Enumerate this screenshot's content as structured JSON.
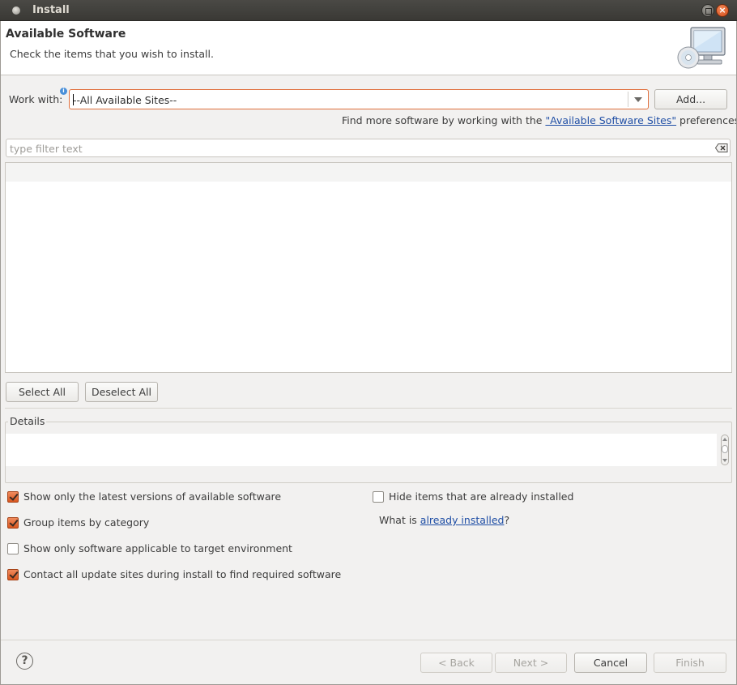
{
  "window": {
    "title": "Install"
  },
  "header": {
    "title": "Available Software",
    "description": "Check the items that you wish to install."
  },
  "work_with": {
    "label": "Work with:",
    "value": "--All Available Sites--",
    "add_button": "Add..."
  },
  "find_more": {
    "prefix": "Find more software by working with the ",
    "link": "\"Available Software Sites\"",
    "suffix": " preferences."
  },
  "filter": {
    "placeholder": "type filter text"
  },
  "selection_buttons": {
    "select_all": "Select All",
    "deselect_all": "Deselect All"
  },
  "details": {
    "label": "Details"
  },
  "options": {
    "left": [
      {
        "label": "Show only the latest versions of available software",
        "checked": true
      },
      {
        "label": "Group items by category",
        "checked": true
      },
      {
        "label": "Show only software applicable to target environment",
        "checked": false
      },
      {
        "label": "Contact all update sites during install to find required software",
        "checked": true
      }
    ],
    "right": [
      {
        "label": "Hide items that are already installed",
        "checked": false
      }
    ]
  },
  "what_is": {
    "prefix": "What is ",
    "link": "already installed",
    "suffix": "?"
  },
  "footer": {
    "help": "?",
    "back": "< Back",
    "next": "Next >",
    "cancel": "Cancel",
    "finish": "Finish"
  },
  "colors": {
    "accent": "#e06f3c",
    "link": "#1f4ea5",
    "checkbox_checked": "#d9571f"
  }
}
